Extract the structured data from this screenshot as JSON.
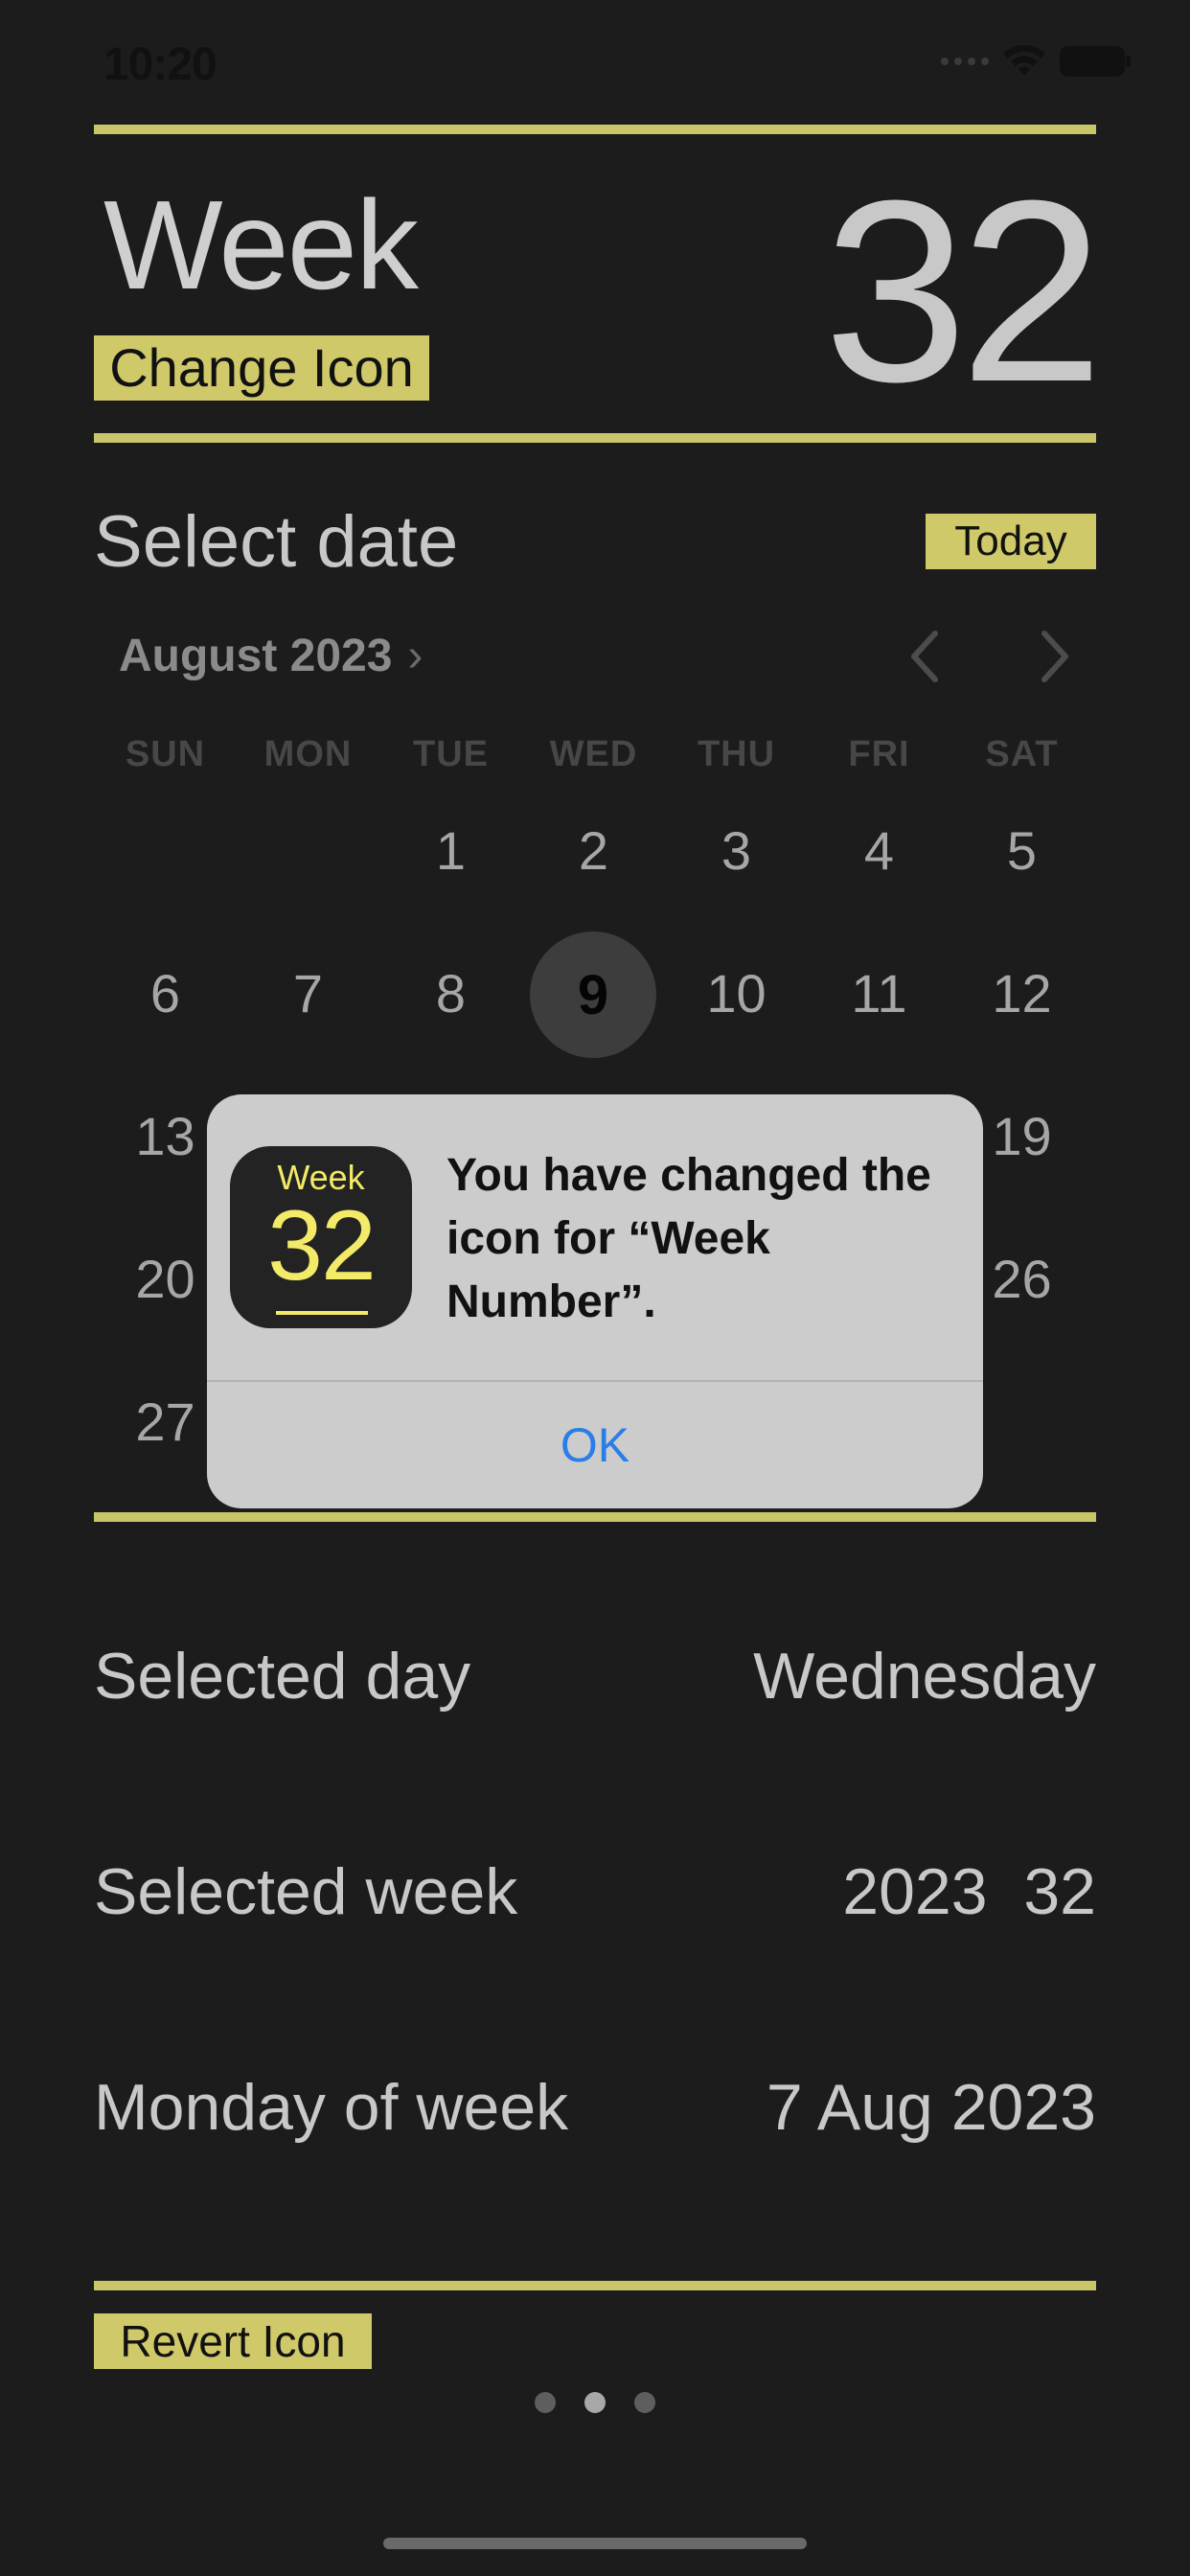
{
  "status_bar": {
    "time": "10:20",
    "icons": [
      "cellular-icon",
      "wifi-icon",
      "battery-icon"
    ]
  },
  "header": {
    "title": "Week",
    "week_number": "32",
    "change_icon_label": "Change Icon"
  },
  "date_picker": {
    "section_title": "Select date",
    "today_label": "Today",
    "month_label": "August 2023",
    "weekdays": [
      "SUN",
      "MON",
      "TUE",
      "WED",
      "THU",
      "FRI",
      "SAT"
    ],
    "days": {
      "d1": "1",
      "d2": "2",
      "d3": "3",
      "d4": "4",
      "d5": "5",
      "d6": "6",
      "d7": "7",
      "d8": "8",
      "d9": "9",
      "d10": "10",
      "d11": "11",
      "d12": "12",
      "d13": "13",
      "d19": "19",
      "d20": "20",
      "d26": "26",
      "d27": "27"
    },
    "selected_day": "9"
  },
  "alert": {
    "icon_word": "Week",
    "icon_number": "32",
    "message": "You have changed the icon for “Week Number”.",
    "ok_label": "OK"
  },
  "info": {
    "selected_day_label": "Selected day",
    "selected_day_value": "Wednesday",
    "selected_week_label": "Selected week",
    "selected_week_value": "2023  32",
    "monday_label": "Monday of week",
    "monday_value": "7 Aug 2023"
  },
  "footer": {
    "revert_icon_label": "Revert Icon",
    "page_count": 3,
    "active_page": 2
  },
  "colors": {
    "background": "#1c1c1c",
    "accent": "#cfc96a",
    "alert_background": "#cccccc",
    "link_blue": "#2a7ee8",
    "icon_yellow": "#f3ea67"
  }
}
